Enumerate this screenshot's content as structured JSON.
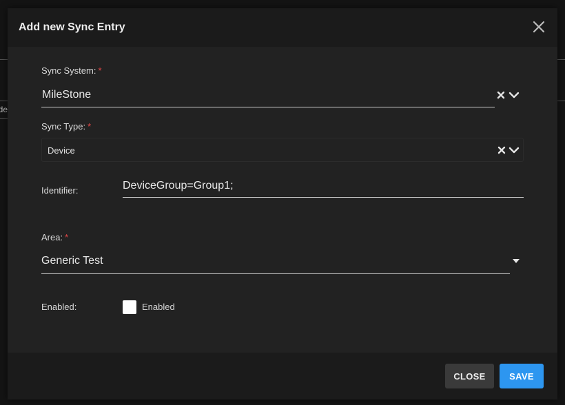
{
  "background": {
    "peek_text": "Ide"
  },
  "dialog": {
    "title": "Add new Sync Entry"
  },
  "fields": {
    "sync_system": {
      "label": "Sync System:",
      "required_mark": "*",
      "value": "MileStone"
    },
    "sync_type": {
      "label": "Sync Type:",
      "required_mark": "*",
      "value": "Device"
    },
    "identifier": {
      "label": "Identifier:",
      "value": "DeviceGroup=Group1;"
    },
    "area": {
      "label": "Area:",
      "required_mark": "*",
      "value": "Generic Test"
    },
    "enabled": {
      "label": "Enabled:",
      "checkbox_label": "Enabled",
      "checked": false
    }
  },
  "footer": {
    "close_label": "CLOSE",
    "save_label": "SAVE"
  },
  "icons": {
    "dialog_close": "close-icon",
    "clear": "clear-x-icon",
    "dropdown": "chevron-down-icon",
    "caret": "caret-down-icon"
  },
  "colors": {
    "accent": "#2d96f0",
    "required": "#e84848",
    "surface": "#222222",
    "header": "#1b1b1b"
  }
}
